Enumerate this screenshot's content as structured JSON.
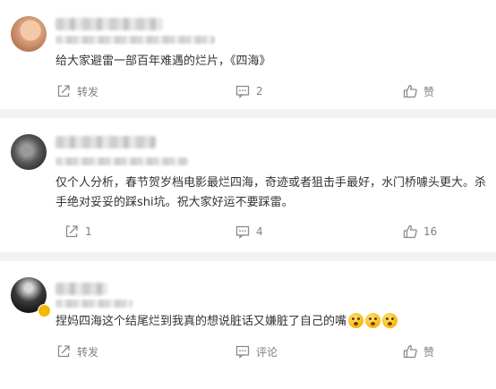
{
  "comments": [
    {
      "text": "给大家避雷一部百年难遇的烂片，《四海》",
      "repost_label": "转发",
      "comment_count": "2",
      "like_label": "赞",
      "emoji_count": 0
    },
    {
      "text": "仅个人分析，春节贺岁档电影最烂四海，奇迹或者狙击手最好，水门桥噱头更大。杀手绝对妥妥的踩shi坑。祝大家好运不要踩雷。",
      "repost_count": "1",
      "comment_count": "4",
      "like_count": "16",
      "emoji_count": 0
    },
    {
      "text": "捏妈四海这个结尾烂到我真的想说脏话又嫌脏了自己的嘴",
      "repost_label": "转发",
      "comment_label": "评论",
      "like_label": "赞",
      "emoji_count": 3
    }
  ],
  "icons": [
    "repost-icon",
    "comment-icon",
    "like-icon"
  ],
  "colors": {
    "text": "#333333",
    "muted": "#808080",
    "separator": "#f2f2f2"
  }
}
